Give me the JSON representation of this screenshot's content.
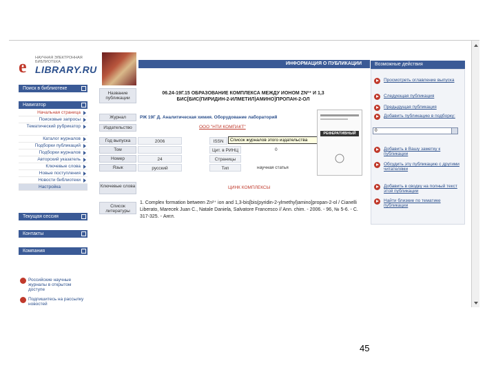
{
  "logo": {
    "letter": "e",
    "subtitle": "НАУЧНАЯ ЭЛЕКТРОННАЯ БИБЛИОТЕКА",
    "name": "LIBRARY.RU"
  },
  "sidebar": {
    "search_label": "Поиск в библиотеке",
    "navigator_label": "Навигатор",
    "nav_items": [
      {
        "label": "Начальная страница",
        "red": true
      },
      {
        "label": "Поисковые запросы",
        "red": false
      },
      {
        "label": "Тематический рубрикатор",
        "red": false
      },
      {
        "label": "Каталог журналов",
        "red": false
      },
      {
        "label": "Подборки публикаций",
        "red": false
      },
      {
        "label": "Подборки журналов",
        "red": false
      },
      {
        "label": "Авторский указатель",
        "red": false
      },
      {
        "label": "Ключевые слова",
        "red": false
      },
      {
        "label": "Новые поступления",
        "red": false
      },
      {
        "label": "Новости библиотеки",
        "red": false
      }
    ],
    "settings_label": "Настройка",
    "current_session_label": "Текущая сессия",
    "contacts_label": "Контакты",
    "company_label": "Компания",
    "promos": [
      "Российские научные журналы в открытом доступе",
      "Подпишитесь на рассылку новостей"
    ]
  },
  "publication": {
    "header": "ИНФОРМАЦИЯ О ПУБЛИКАЦИИ",
    "labels": {
      "title": "Название публикации",
      "journal": "Журнал",
      "publisher": "Издательство",
      "year": "Год выпуска",
      "volume": "Том",
      "number": "Номер",
      "language": "Язык",
      "keywords": "Ключевые слова",
      "references": "Список литературы"
    },
    "title": "06.24-19Г.15 ОБРАЗОВАНИЕ КОМПЛЕКСА МЕЖДУ ИОНОМ ZN²⁺ И 1,3 БИС[БИС(ПИРИДИН-2-ИЛМЕТИЛ)АМИНО]ПРОПАН-2-ОЛ",
    "journal": "РЖ 19Г Д. Аналитическая химия. Оборудование лабораторий",
    "publisher": "ООО \"НТИ КОМПАКТ\"",
    "year": "2006",
    "issn_label": "ISSN",
    "volume": "",
    "rinc_label": "Цит. в РИНЦ",
    "rinc_value": "0",
    "number": "24",
    "pages_label": "Страницы",
    "language": "русский",
    "type_label": "Тип",
    "type_value": "научная статья",
    "keywords_value": "ЦИНК КОМПЛЕКСЫ",
    "tooltip": "Список журналов этого издательства",
    "journal_cover_text": "РЕФЕРАТИВНЫЙ ЖУРНАЛ",
    "reference_number": "1.",
    "reference_text": "Complex formation between Zn²⁺ ion and 1,3-bis[bis(pyridin-2-ylmethyl)amino]propan-2-ol / Cianelli Liberato, Marecek Juan C., Natale Daniela, Salvatore Francesco // Ann. chim. - 2006. - 96, № 5-6. - С. 317-325. - Англ."
  },
  "actions": {
    "header": "Возможные действия",
    "items": [
      "Просмотреть оглавление выпуска",
      "Следующая публикация",
      "Предыдущая публикация",
      "Добавить публикацию в подборку:",
      "Добавить в Вашу заметку к публикации",
      "Обсудить эту публикацию с другими читателями",
      "Добавить в сводку на полный текст этой публикации",
      "Найти близкие по тематике публикации"
    ],
    "select_value": "0"
  },
  "page_number": "45",
  "colors": {
    "accent": "#3a5a96",
    "red": "#c0392b"
  }
}
